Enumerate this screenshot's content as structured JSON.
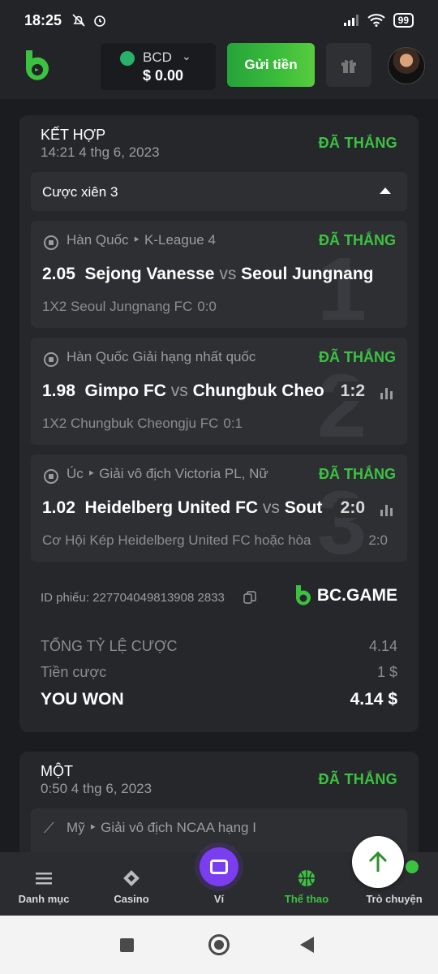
{
  "status_bar": {
    "time": "18:25",
    "battery": "99"
  },
  "header": {
    "currency": "BCD",
    "balance": "$ 0.00",
    "deposit_label": "Gửi tiền"
  },
  "bet1": {
    "title": "KẾT HỢP",
    "date": "14:21 4 thg 6, 2023",
    "status": "ĐÃ THẮNG",
    "parlay_label": "Cược xiên 3",
    "legs": [
      {
        "num": "1",
        "league": "Hàn Quốc ‣ K-League 4",
        "status": "ĐÃ THẮNG",
        "odds": "2.05",
        "home": "Sejong Vanesse",
        "vs": "vs",
        "away": "Seoul Jungnang",
        "score": "",
        "pick": "1X2 Seoul Jungnang FC",
        "pick_score": "0:0"
      },
      {
        "num": "2",
        "league": "Hàn Quốc Giải hạng nhất quốc",
        "status": "ĐÃ THẮNG",
        "odds": "1.98",
        "home": "Gimpo FC",
        "vs": "vs",
        "away": "Chungbuk Cheo",
        "score": "1:2",
        "pick": "1X2 Chungbuk Cheongju FC",
        "pick_score": "0:1"
      },
      {
        "num": "3",
        "league": "Úc ‣ Giải vô địch Victoria PL, Nữ",
        "status": "ĐÃ THẮNG",
        "odds": "1.02",
        "home": "Heidelberg United FC",
        "vs": "vs",
        "away": "Sout",
        "score": "2:0",
        "pick": "Cơ Hội Kép Heidelberg United FC hoặc hòa",
        "pick_score": "2:0"
      }
    ],
    "ticket_id": "ID phiếu: 227704049813908 2833",
    "brand": "BC.GAME",
    "total_odds_label": "TỔNG TỶ LỆ CƯỢC",
    "total_odds": "4.14",
    "stake_label": "Tiền cược",
    "stake": "1 $",
    "won_label": "YOU WON",
    "won_amount": "4.14 $"
  },
  "bet2": {
    "title": "MỘT",
    "date": "0:50 4 thg 6, 2023",
    "status": "ĐÃ THẮNG",
    "league": "Mỹ ‣ Giải vô địch NCAA hạng I"
  },
  "bottom_nav": {
    "menu": "Danh mục",
    "casino": "Casino",
    "wallet": "Ví",
    "sports": "Thể thao",
    "chat": "Trò chuyện"
  },
  "colors": {
    "accent_green": "#3cc241",
    "wallet_purple": "#7b3df0",
    "background": "#1b1c1f"
  }
}
